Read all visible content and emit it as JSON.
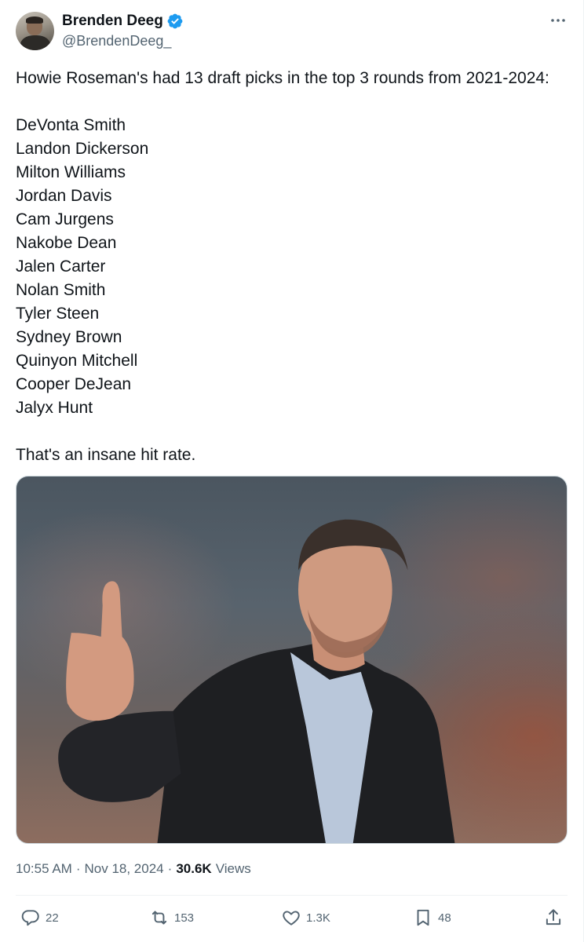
{
  "author": {
    "display_name": "Brenden Deeg",
    "handle": "@BrendenDeeg_",
    "verified": true,
    "verified_color": "#1d9bf0"
  },
  "tweet": {
    "intro": "Howie Roseman's had 13 draft picks in the top 3 rounds from 2021-2024:",
    "picks": [
      "DeVonta Smith",
      "Landon Dickerson",
      "Milton Williams",
      "Jordan Davis",
      "Cam Jurgens",
      "Nakobe Dean",
      "Jalen Carter",
      "Nolan Smith",
      "Tyler Steen",
      "Sydney Brown",
      "Quinyon Mitchell",
      "Cooper DeJean",
      "Jalyx Hunt"
    ],
    "outro": "That's an insane hit rate."
  },
  "meta": {
    "time": "10:55 AM",
    "separator": "·",
    "date": "Nov 18, 2024",
    "views_count": "30.6K",
    "views_label": "Views"
  },
  "actions": {
    "replies": "22",
    "reposts": "153",
    "likes": "1.3K",
    "bookmarks": "48"
  },
  "icons": [
    "more-icon",
    "verified-badge-icon",
    "reply-icon",
    "retweet-icon",
    "like-icon",
    "bookmark-icon",
    "share-icon"
  ]
}
